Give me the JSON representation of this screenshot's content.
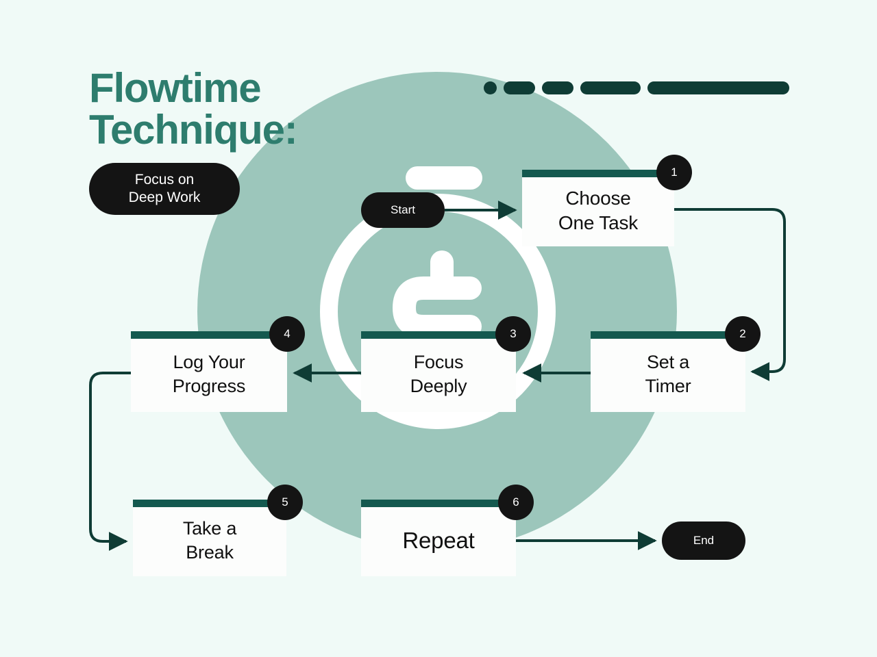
{
  "meta": {
    "background_color": "#f0faf7",
    "accent_teal": "#2e7d6e",
    "dark_teal": "#14594f",
    "sage_green": "#9cc6bb",
    "ink_black": "#141414",
    "connector_color": "#0f3c35"
  },
  "header": {
    "title": "Flowtime\nTechnique:",
    "subtitle": "Focus on\nDeep Work"
  },
  "decoration": {
    "dashes": [
      19,
      46,
      46,
      88,
      207
    ],
    "illustration_name": "stopwatch-illustration"
  },
  "terminals": {
    "start": "Start",
    "end": "End"
  },
  "steps": [
    {
      "number": "1",
      "label": "Choose\nOne Task"
    },
    {
      "number": "2",
      "label": "Set a\nTimer"
    },
    {
      "number": "3",
      "label": "Focus\nDeeply"
    },
    {
      "number": "4",
      "label": "Log Your\nProgress"
    },
    {
      "number": "5",
      "label": "Take a\nBreak"
    },
    {
      "number": "6",
      "label": "Repeat"
    }
  ],
  "flow": {
    "connections": [
      {
        "from": "Start",
        "to": "Choose One Task",
        "style": "straight-right"
      },
      {
        "from": "Choose One Task",
        "to": "Set a Timer",
        "style": "elbow-right-down"
      },
      {
        "from": "Set a Timer",
        "to": "Focus Deeply",
        "style": "straight-left"
      },
      {
        "from": "Focus Deeply",
        "to": "Log Your Progress",
        "style": "straight-left"
      },
      {
        "from": "Log Your Progress",
        "to": "Take a Break",
        "style": "elbow-left-down"
      },
      {
        "from": "Repeat",
        "to": "End",
        "style": "straight-right"
      }
    ]
  }
}
